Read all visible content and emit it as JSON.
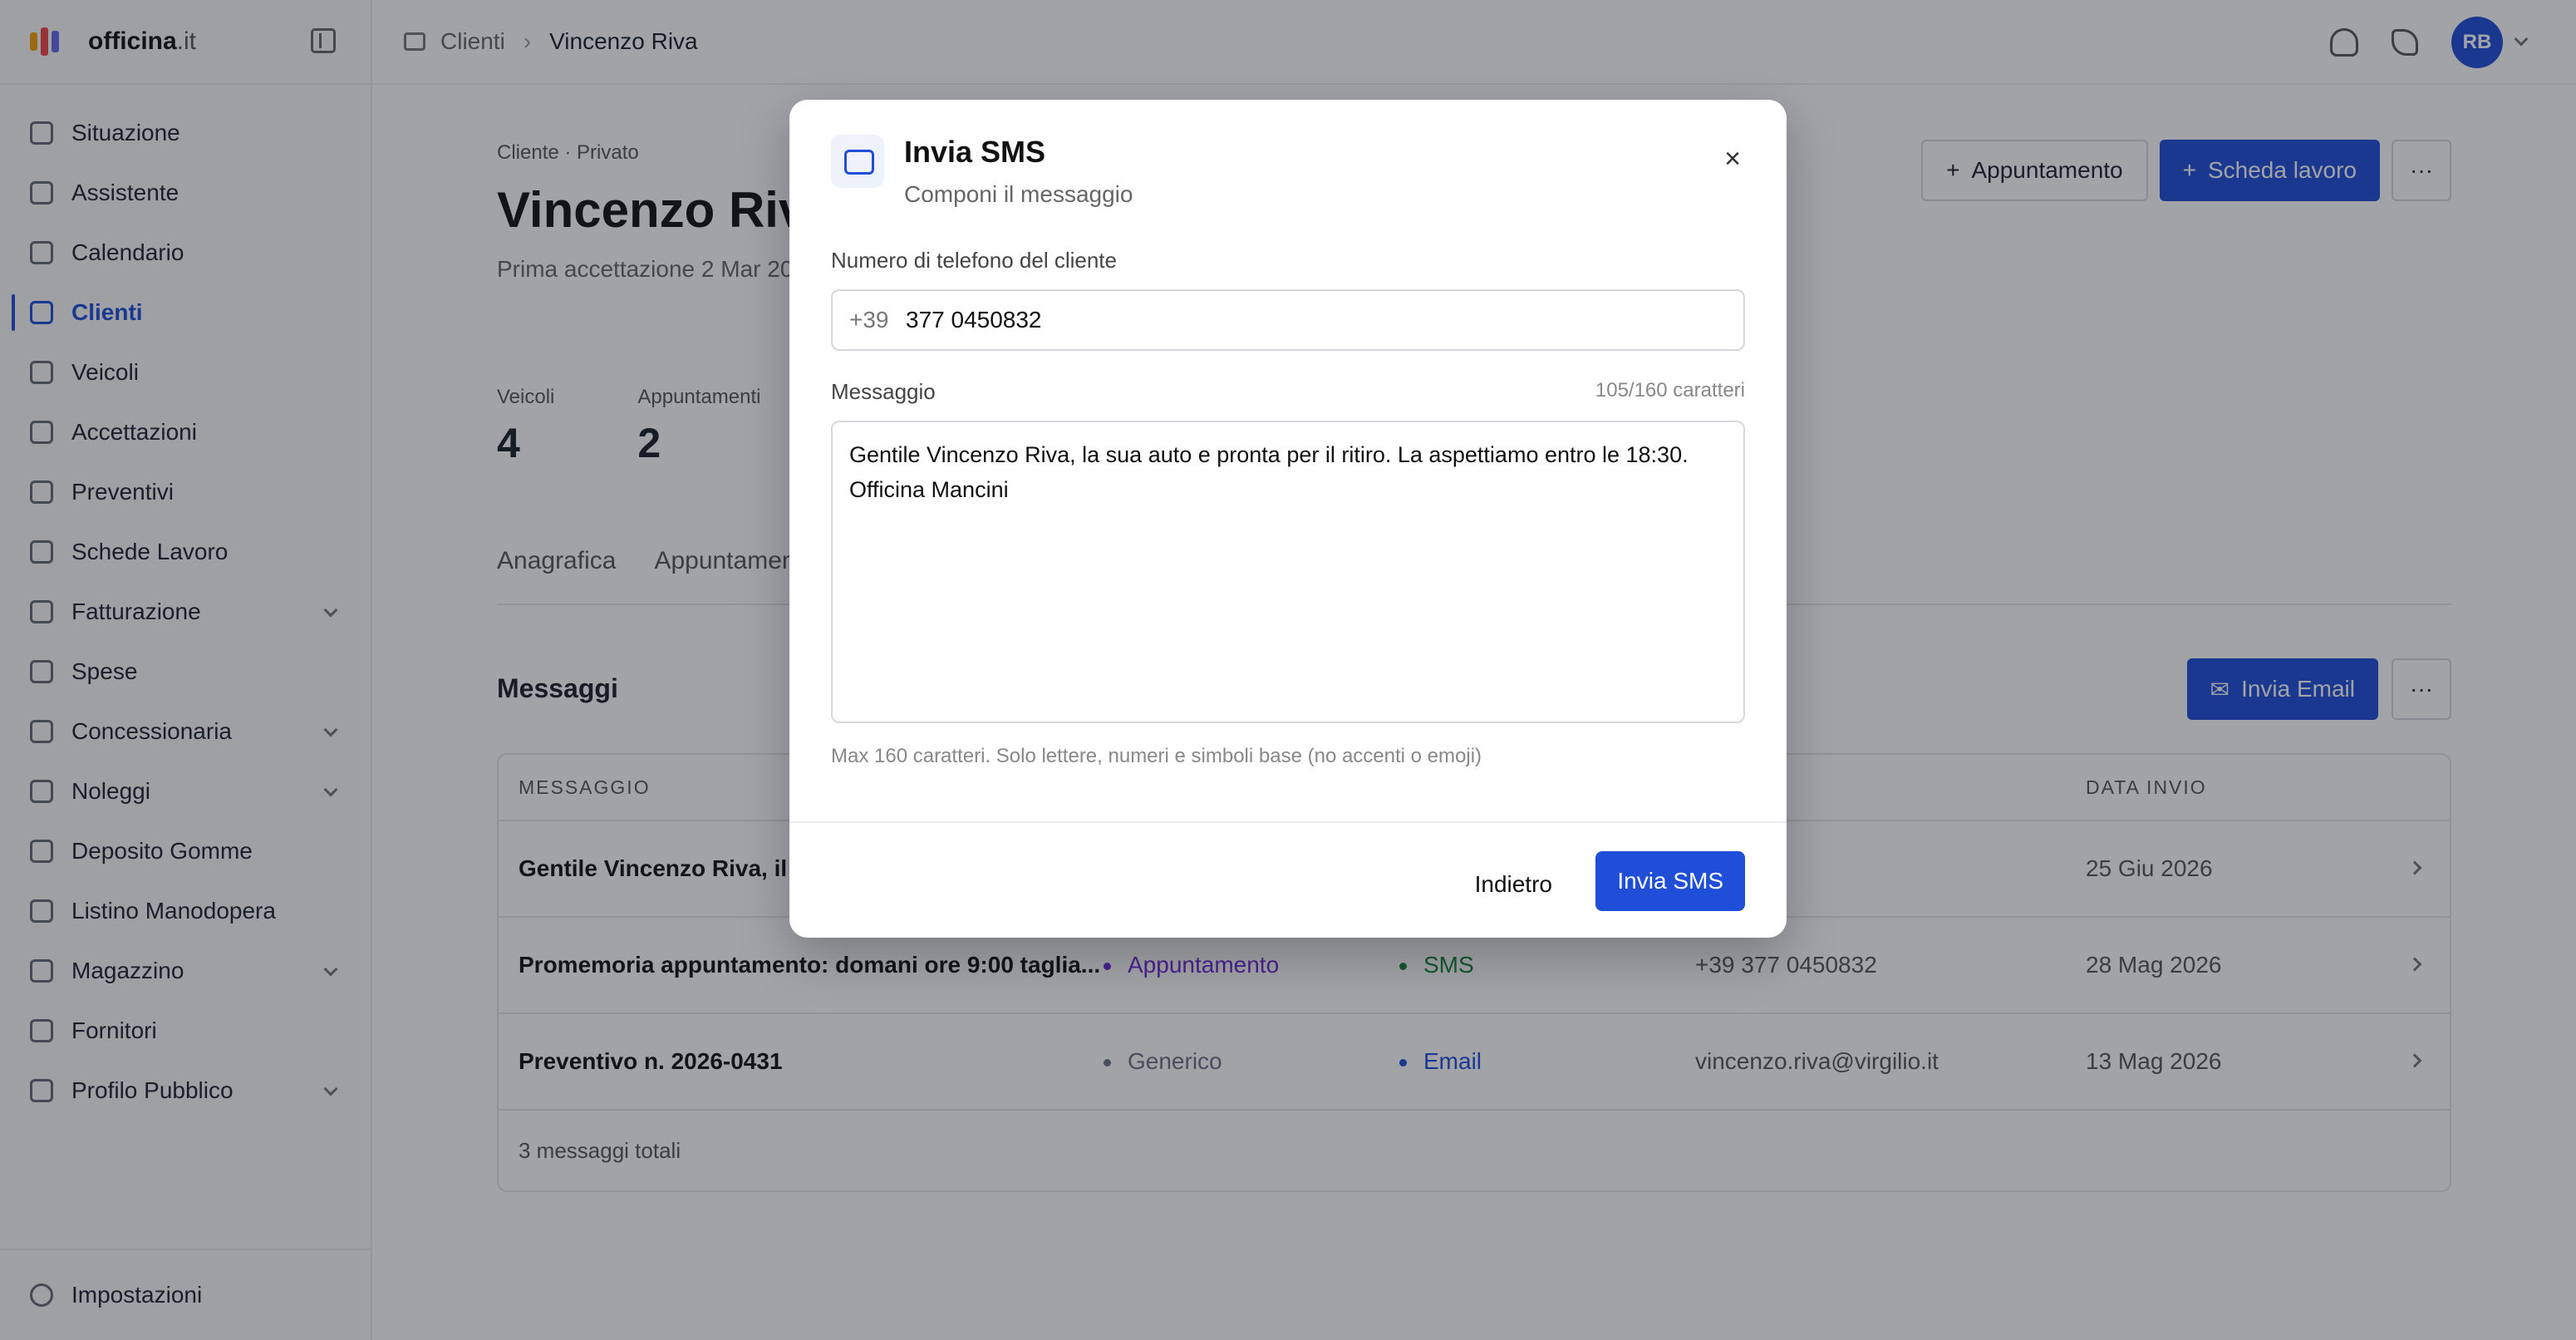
{
  "brand": {
    "name": "officina",
    "suffix": ".it"
  },
  "sidebar": {
    "items": [
      {
        "label": "Situazione",
        "has_submenu": false,
        "active": false
      },
      {
        "label": "Assistente",
        "has_submenu": false,
        "active": false
      },
      {
        "label": "Calendario",
        "has_submenu": false,
        "active": false
      },
      {
        "label": "Clienti",
        "has_submenu": false,
        "active": true
      },
      {
        "label": "Veicoli",
        "has_submenu": false,
        "active": false
      },
      {
        "label": "Accettazioni",
        "has_submenu": false,
        "active": false
      },
      {
        "label": "Preventivi",
        "has_submenu": false,
        "active": false
      },
      {
        "label": "Schede Lavoro",
        "has_submenu": false,
        "active": false
      },
      {
        "label": "Fatturazione",
        "has_submenu": true,
        "active": false
      },
      {
        "label": "Spese",
        "has_submenu": false,
        "active": false
      },
      {
        "label": "Concessionaria",
        "has_submenu": true,
        "active": false
      },
      {
        "label": "Noleggi",
        "has_submenu": true,
        "active": false
      },
      {
        "label": "Deposito Gomme",
        "has_submenu": false,
        "active": false
      },
      {
        "label": "Listino Manodopera",
        "has_submenu": false,
        "active": false
      },
      {
        "label": "Magazzino",
        "has_submenu": true,
        "active": false
      },
      {
        "label": "Fornitori",
        "has_submenu": false,
        "active": false
      },
      {
        "label": "Profilo Pubblico",
        "has_submenu": true,
        "active": false
      }
    ],
    "footer": "Impostazioni"
  },
  "breadcrumb": {
    "parent": "Clienti",
    "current": "Vincenzo Riva"
  },
  "user": {
    "initials": "RB"
  },
  "client": {
    "kind": "Cliente · Privato",
    "name": "Vincenzo Riva",
    "since": "Prima accettazione 2 Mar 20"
  },
  "header_actions": {
    "appointment": "Appuntamento",
    "worksheet": "Scheda lavoro"
  },
  "stats": [
    {
      "label": "Veicoli",
      "value": "4"
    },
    {
      "label": "Appuntamenti",
      "value": "2"
    }
  ],
  "tabs": [
    "Anagrafica",
    "Appuntamen"
  ],
  "messages": {
    "title": "Messaggi",
    "send_email": "Invia Email",
    "columns": [
      "MESSAGGIO",
      "",
      "",
      "ARIO",
      "DATA INVIO"
    ],
    "rows": [
      {
        "text": "Gentile Vincenzo Riva, il su",
        "type": "",
        "channel": "",
        "recipient": "0450832",
        "date": "25 Giu 2026"
      },
      {
        "text": "Promemoria appuntamento: domani ore 9:00 taglia...",
        "type": "Appuntamento",
        "channel": "SMS",
        "recipient": "+39 377 0450832",
        "date": "28 Mag 2026"
      },
      {
        "text": "Preventivo n. 2026-0431",
        "type": "Generico",
        "channel": "Email",
        "recipient": "vincenzo.riva@virgilio.it",
        "date": "13 Mag 2026"
      }
    ],
    "total": "3 messaggi totali"
  },
  "modal": {
    "title": "Invia SMS",
    "subtitle": "Componi il messaggio",
    "phone_label": "Numero di telefono del cliente",
    "phone_prefix": "+39",
    "phone_value": "377 0450832",
    "message_label": "Messaggio",
    "counter": "105/160 caratteri",
    "message_value": "Gentile Vincenzo Riva, la sua auto e pronta per il ritiro. La aspettiamo entro le 18:30.\nOfficina Mancini",
    "hint": "Max 160 caratteri. Solo lettere, numeri e simboli base (no accenti o emoji)",
    "back": "Indietro",
    "send": "Invia SMS"
  },
  "colors": {
    "accent": "#1f4ed8",
    "tag_appointment": "#6d28d9",
    "tag_sms": "#15803d",
    "tag_email": "#1f4ed8",
    "tag_generic": "#6b7280"
  }
}
